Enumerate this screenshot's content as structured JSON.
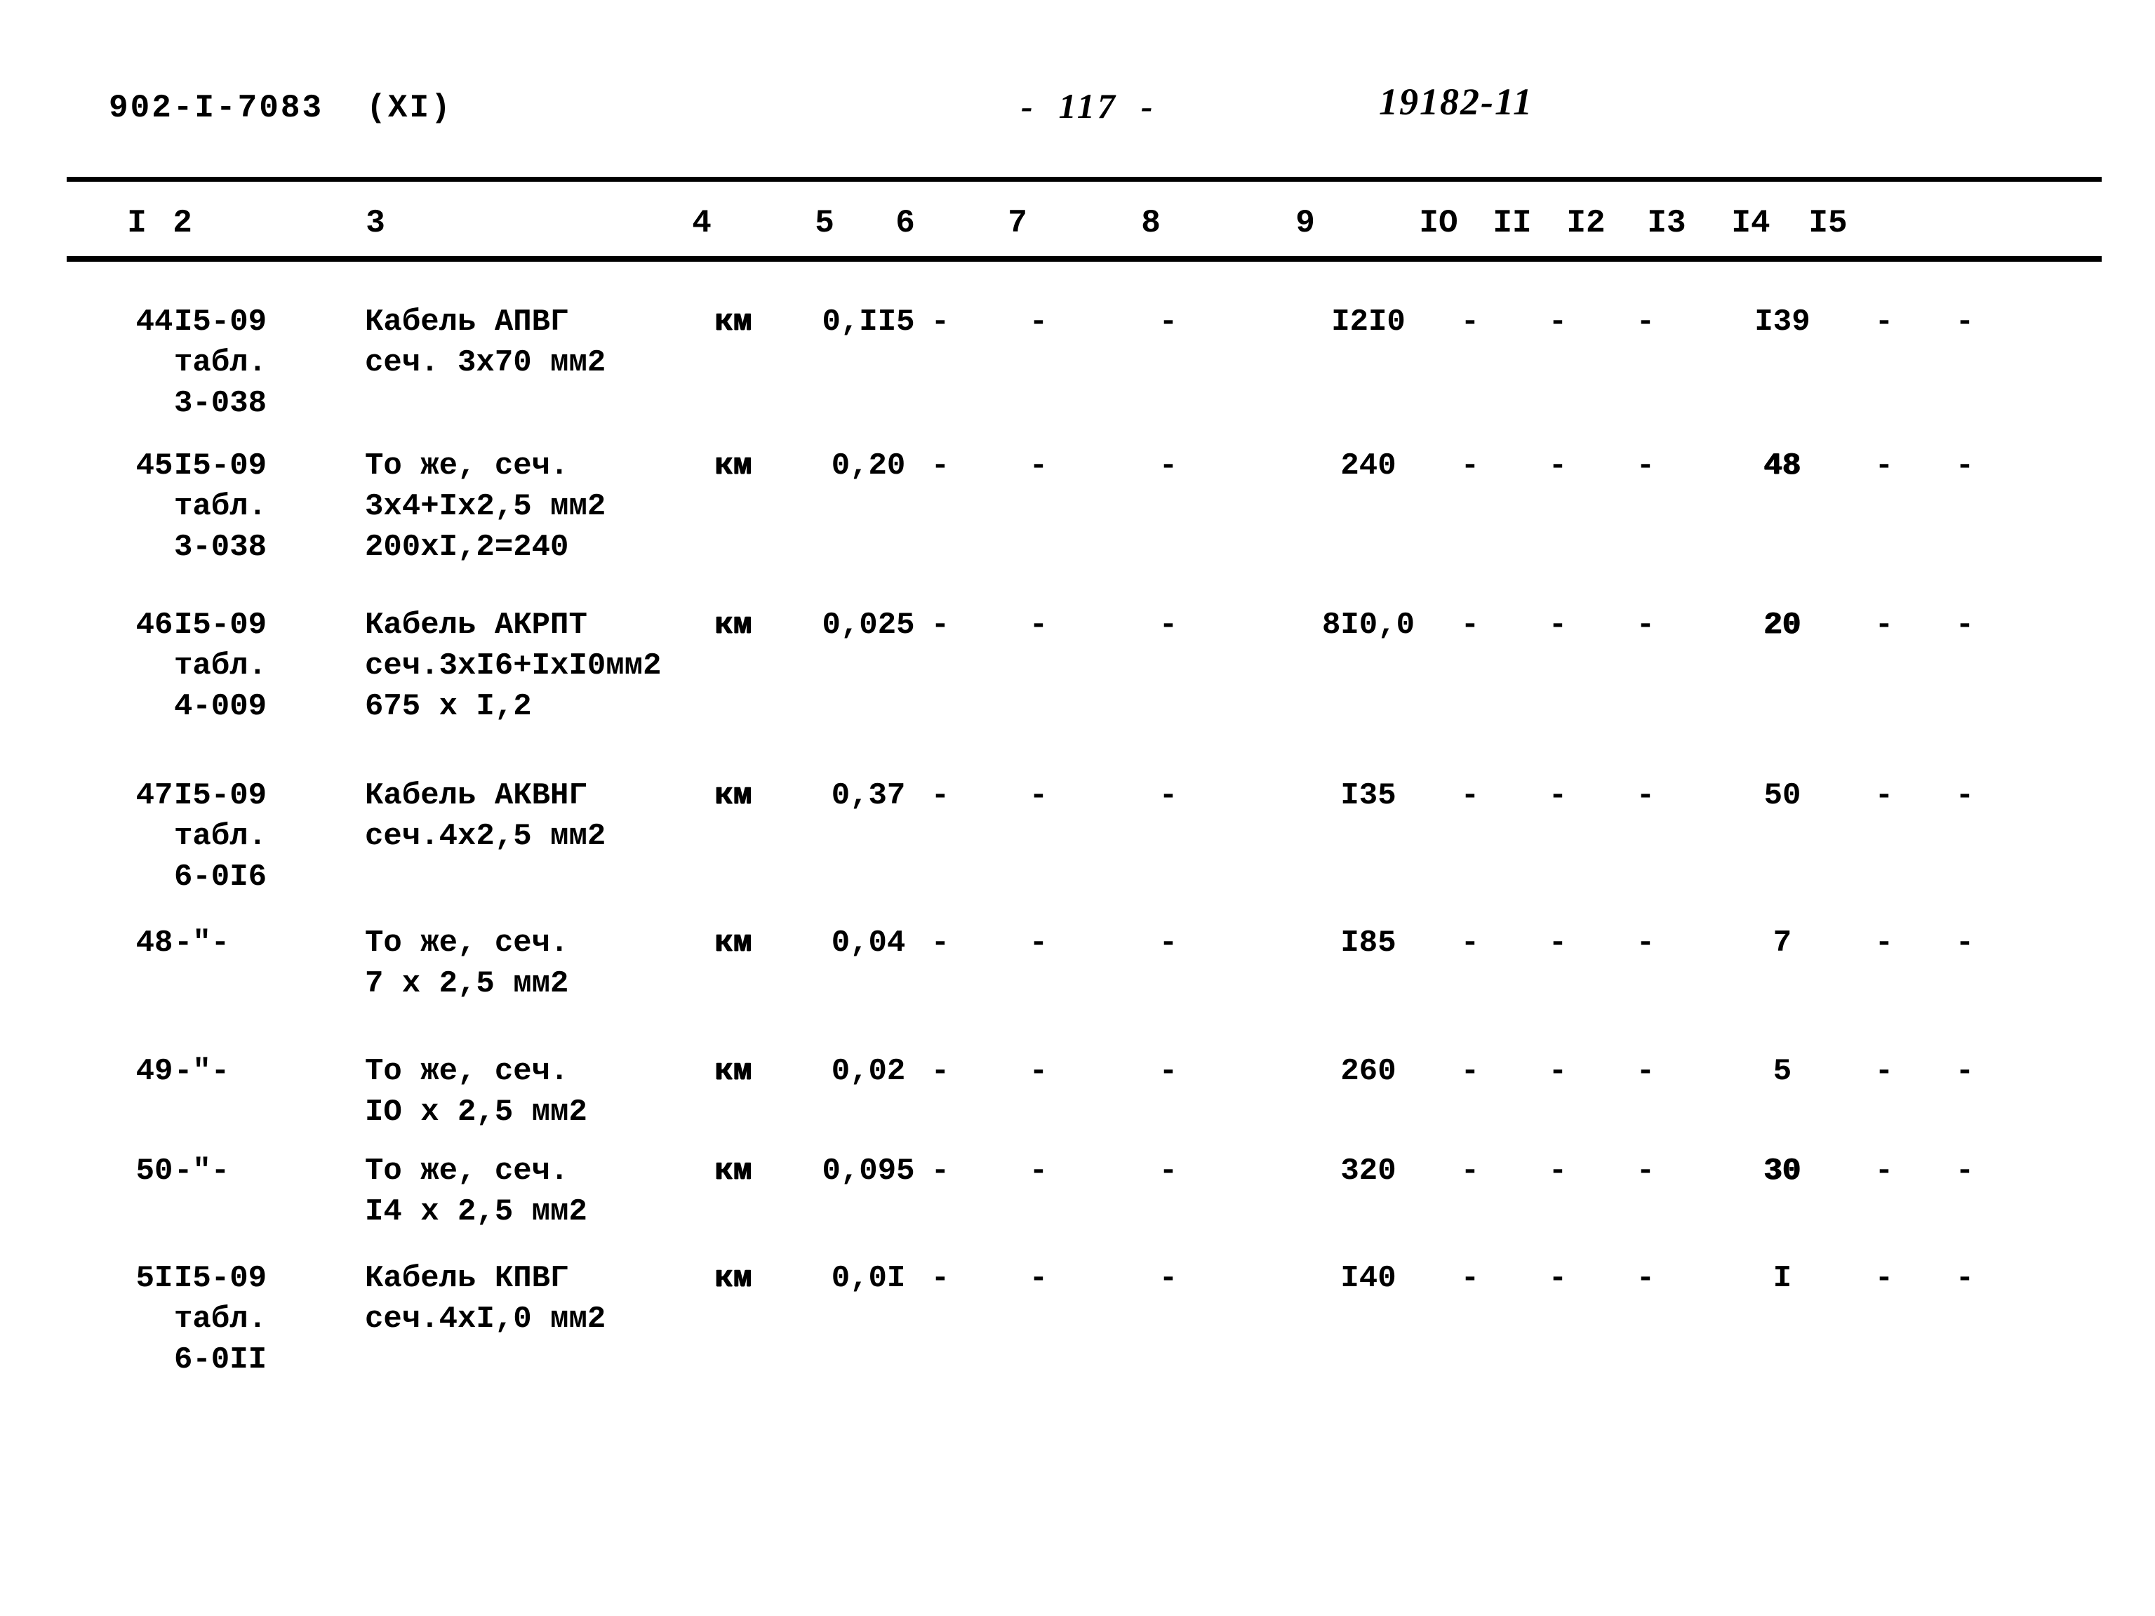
{
  "header": {
    "doc_code": "902-I-7083  (XI)",
    "page_number": "-  117  -",
    "stamp_number": "19182-11"
  },
  "table": {
    "column_headers": [
      "I",
      "2",
      "3",
      "4",
      "5",
      "6",
      "7",
      "8",
      "9",
      "IO",
      "II",
      "I2",
      "I3",
      "I4",
      "I5"
    ],
    "rows": [
      {
        "c1": "44",
        "c2": [
          "I5-09",
          "табл.",
          "3-038"
        ],
        "c3": [
          "Кабель АПВГ",
          "сеч. 3х70 мм2"
        ],
        "c4": "км",
        "c5": "0,II5",
        "c6": "-",
        "c7": "-",
        "c8": "-",
        "c9": "I2I0",
        "c10": "-",
        "c11": "-",
        "c12": "-",
        "c13": "I39",
        "c14": "-",
        "c15": "-"
      },
      {
        "c1": "45",
        "c2": [
          "I5-09",
          "табл.",
          "3-038"
        ],
        "c3": [
          "То же, сеч.",
          "3х4+Iх2,5 мм2",
          "200хI,2=240"
        ],
        "c4": "км",
        "c5": "0,20",
        "c6": "-",
        "c7": "-",
        "c8": "-",
        "c9": "240",
        "c10": "-",
        "c11": "-",
        "c12": "-",
        "c13": "48",
        "c14": "-",
        "c15": "-"
      },
      {
        "c1": "46",
        "c2": [
          "I5-09",
          "табл.",
          "4-009"
        ],
        "c3": [
          "Кабель АКРПТ",
          "сеч.3хI6+IхI0мм2",
          "675 х I,2"
        ],
        "c4": "км",
        "c5": "0,025",
        "c6": "-",
        "c7": "-",
        "c8": "-",
        "c9": "8I0,0",
        "c10": "-",
        "c11": "-",
        "c12": "-",
        "c13": "20",
        "c14": "-",
        "c15": "-"
      },
      {
        "c1": "47",
        "c2": [
          "I5-09",
          "табл.",
          "6-0I6"
        ],
        "c3": [
          "Кабель АКВНГ",
          "сеч.4х2,5 мм2"
        ],
        "c4": "км",
        "c5": "0,37",
        "c6": "-",
        "c7": "-",
        "c8": "-",
        "c9": "I35",
        "c10": "-",
        "c11": "-",
        "c12": "-",
        "c13": "50",
        "c14": "-",
        "c15": "-"
      },
      {
        "c1": "48",
        "c2": [
          "-\"-"
        ],
        "c3": [
          "То же, сеч.",
          "7 х 2,5 мм2"
        ],
        "c4": "км",
        "c5": "0,04",
        "c6": "-",
        "c7": "-",
        "c8": "-",
        "c9": "I85",
        "c10": "-",
        "c11": "-",
        "c12": "-",
        "c13": "7",
        "c14": "-",
        "c15": "-"
      },
      {
        "c1": "49",
        "c2": [
          "-\"-"
        ],
        "c3": [
          "То же, сеч.",
          "IO х 2,5 мм2"
        ],
        "c4": "км",
        "c5": "0,02",
        "c6": "-",
        "c7": "-",
        "c8": "-",
        "c9": "260",
        "c10": "-",
        "c11": "-",
        "c12": "-",
        "c13": "5",
        "c14": "-",
        "c15": "-"
      },
      {
        "c1": "50",
        "c2": [
          "-\"-"
        ],
        "c3": [
          "То же, сеч.",
          "I4 х 2,5 мм2"
        ],
        "c4": "км",
        "c5": "0,095",
        "c6": "-",
        "c7": "-",
        "c8": "-",
        "c9": "320",
        "c10": "-",
        "c11": "-",
        "c12": "-",
        "c13": "30",
        "c14": "-",
        "c15": "-"
      },
      {
        "c1": "5I",
        "c2": [
          "I5-09",
          "табл.",
          "6-0II"
        ],
        "c3": [
          "Кабель КПВГ",
          "сеч.4хI,0 мм2"
        ],
        "c4": "км",
        "c5": "0,0I",
        "c6": "-",
        "c7": "-",
        "c8": "-",
        "c9": "I40",
        "c10": "-",
        "c11": "-",
        "c12": "-",
        "c13": "I",
        "c14": "-",
        "c15": "-"
      }
    ]
  }
}
